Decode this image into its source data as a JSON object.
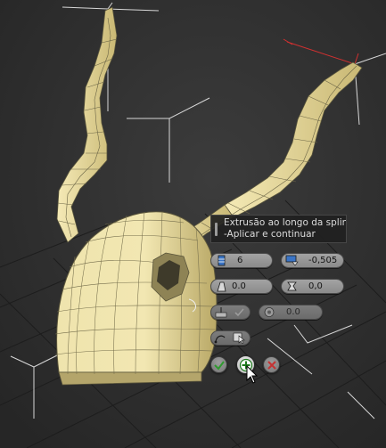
{
  "tooltip": {
    "line1": "Extrusão ao longo da spline",
    "line2": "-Aplicar e continuar"
  },
  "caddy": {
    "segments": "6",
    "taper_amount": "-0,505",
    "taper_curve": "0.0",
    "twist": "0,0",
    "rotation": "0.0"
  },
  "icons": {
    "segments": "segments-icon",
    "taper_amount": "taper-amount-icon",
    "taper_curve": "taper-curve-icon",
    "twist": "twist-icon",
    "align_normal": "align-to-face-normal-icon",
    "rotation": "rotation-icon",
    "pick_spline": "pick-spline-icon",
    "ok": "checkmark-icon",
    "apply_continue": "plus-icon",
    "cancel": "x-icon"
  },
  "colors": {
    "viewport_bg": "#2d2d2d",
    "mesh_fill": "#efe3a8",
    "ok_green": "#3aa23a",
    "cancel_red": "#c43434",
    "selection_red": "#d82a2a"
  }
}
